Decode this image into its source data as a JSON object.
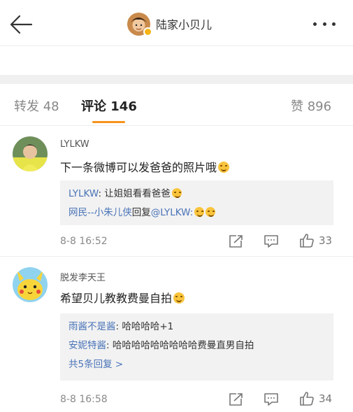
{
  "header": {
    "title": "陆家小贝儿",
    "back_icon": "arrow-left-icon",
    "more_icon": "more-dots-icon",
    "verified_badge_color": "#f6b516"
  },
  "tabs": {
    "repost": {
      "label": "转发",
      "count": "48"
    },
    "comments": {
      "label": "评论",
      "count": "146"
    },
    "likes": {
      "label": "赞",
      "count": "896"
    },
    "active_color": "#f7931e"
  },
  "comments": [
    {
      "user": "LYLKW",
      "text": "下一条微博可以发爸爸的照片哦",
      "replies": [
        {
          "user": "LYLKW",
          "sep": ": ",
          "text": "让姐姐看看爸爸"
        },
        {
          "user": "网民--小朱儿侠",
          "mid": "回复",
          "mention": "@LYLKW",
          "sep": ":",
          "text": ""
        }
      ],
      "time": "8-8 16:52",
      "likes": "33"
    },
    {
      "user": "脱发李天王",
      "text": "希望贝儿教教费曼自拍",
      "replies": [
        {
          "user": "雨酱不是酱",
          "sep": ": ",
          "text": "哈哈哈哈+1"
        },
        {
          "user": "安妮特酱",
          "sep": ": ",
          "text": "哈哈哈哈哈哈哈哈哈费曼直男自拍"
        }
      ],
      "more_replies": "共5条回复 >",
      "time": "8-8 16:58",
      "likes": "34"
    }
  ],
  "link_color": "#4a74b8"
}
